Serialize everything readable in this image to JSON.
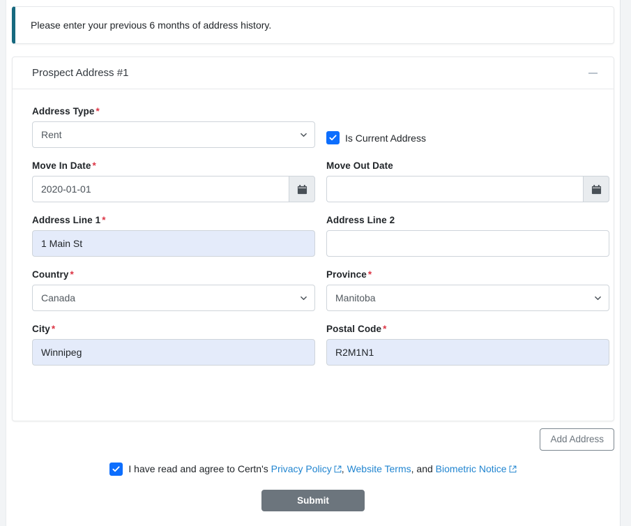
{
  "alert": {
    "message": "Please enter your previous 6 months of address history.",
    "accent_color": "#17697f"
  },
  "card": {
    "title": "Prospect Address #1",
    "collapse_icon": "minus-icon"
  },
  "form": {
    "address_type": {
      "label": "Address Type",
      "required": "*",
      "value": "Rent",
      "icon": "chevron-down-icon"
    },
    "is_current_address": {
      "label": "Is Current Address",
      "checked": true,
      "icon": "check-icon"
    },
    "move_in_date": {
      "label": "Move In Date",
      "required": "*",
      "value": "2020-01-01",
      "placeholder": "",
      "icon": "calendar-icon"
    },
    "move_out_date": {
      "label": "Move Out Date",
      "required": "",
      "value": "",
      "placeholder": "",
      "icon": "calendar-icon"
    },
    "address_line_1": {
      "label": "Address Line 1",
      "required": "*",
      "value": "1 Main St",
      "placeholder": ""
    },
    "address_line_2": {
      "label": "Address Line 2",
      "required": "",
      "value": "",
      "placeholder": ""
    },
    "country": {
      "label": "Country",
      "required": "*",
      "value": "Canada",
      "icon": "chevron-down-icon"
    },
    "province": {
      "label": "Province",
      "required": "*",
      "value": "Manitoba",
      "icon": "chevron-down-icon"
    },
    "city": {
      "label": "City",
      "required": "*",
      "value": "Winnipeg",
      "placeholder": ""
    },
    "postal_code": {
      "label": "Postal Code",
      "required": "*",
      "value": "R2M1N1",
      "placeholder": ""
    }
  },
  "actions": {
    "add_address_label": "Add Address",
    "submit_label": "Submit"
  },
  "consent": {
    "checked": true,
    "text_before": "I have read and agree to Certn's",
    "privacy_policy": "Privacy Policy",
    "comma": ",",
    "website_terms": "Website Terms",
    "and": ", and",
    "biometric_notice": "Biometric Notice",
    "external_icon": "external-link-icon"
  },
  "colors": {
    "checkbox_blue": "#0d6efd",
    "link_blue": "#2185d0",
    "required_red": "#dc3545",
    "submit_gray": "#6c757d",
    "autofill_blue": "#e4ebfa"
  }
}
